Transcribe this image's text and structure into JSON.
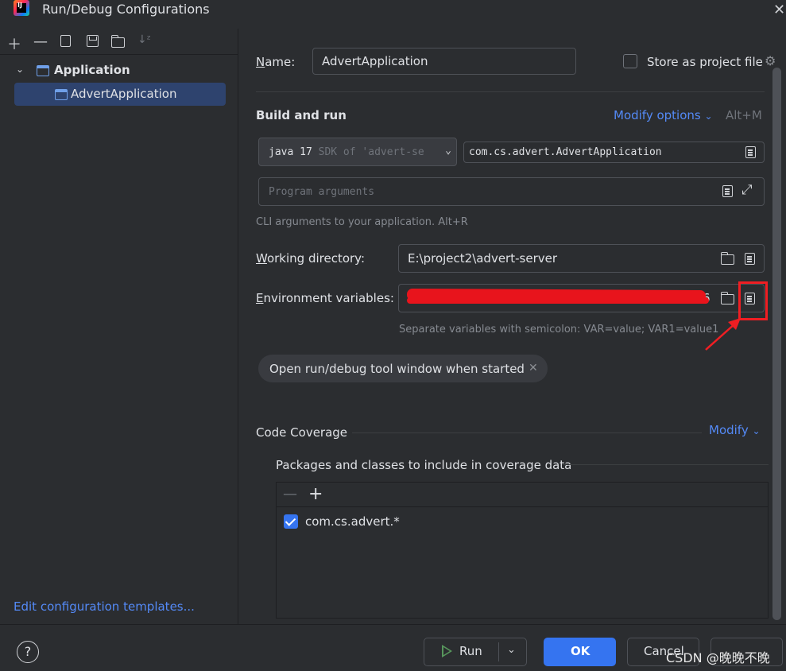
{
  "window": {
    "title": "Run/Debug Configurations",
    "logo_letter": "IJ"
  },
  "icons": {
    "app_logo": "intellij-idea-icon",
    "close": "close-icon",
    "toolbar": [
      "add-icon",
      "remove-icon",
      "copy-icon",
      "save-icon",
      "new-folder-icon",
      "sort-icon"
    ],
    "gear": "gear-icon",
    "doc": "expand-text-icon",
    "folder": "folder-icon",
    "expand": "expand-icon",
    "chevron": "chevron-down-icon",
    "help": "help-icon",
    "run": "run-icon"
  },
  "sidebar": {
    "group_label": "Application",
    "child_label": "AdvertApplication",
    "edit_templates_link": "Edit configuration templates..."
  },
  "form": {
    "name_label": "Name:",
    "name_value": "AdvertApplication",
    "store_label": "Store as project file",
    "build_run_title": "Build and run",
    "modify_options": "Modify options",
    "modify_options_shortcut": "Alt+M",
    "jdk_value": "java 17",
    "jdk_hint": "SDK of 'advert-se",
    "main_class": "com.cs.advert.AdvertApplication",
    "program_args_placeholder": "Program arguments",
    "cli_hint": "CLI arguments to your application. Alt+R",
    "working_dir_label": "Working directory:",
    "working_dir_value": "E:\\project2\\advert-server",
    "env_label": "Environment variables:",
    "env_value_tail": "6",
    "env_hint": "Separate variables with semicolon: VAR=value; VAR1=value1",
    "chip_label": "Open run/debug tool window when started",
    "chip_close": "✕"
  },
  "coverage": {
    "title": "Code Coverage",
    "modify": "Modify",
    "packages_label": "Packages and classes to include in coverage data",
    "items": [
      {
        "label": "com.cs.advert.*",
        "checked": true
      }
    ]
  },
  "footer": {
    "help": "?",
    "run": "Run",
    "ok": "OK",
    "cancel": "Cancel",
    "watermark": "CSDN @晚晚不晚"
  },
  "colors": {
    "accent": "#3574f0",
    "link": "#548af7",
    "highlight": "#f01e23",
    "background": "#2b2d30"
  }
}
